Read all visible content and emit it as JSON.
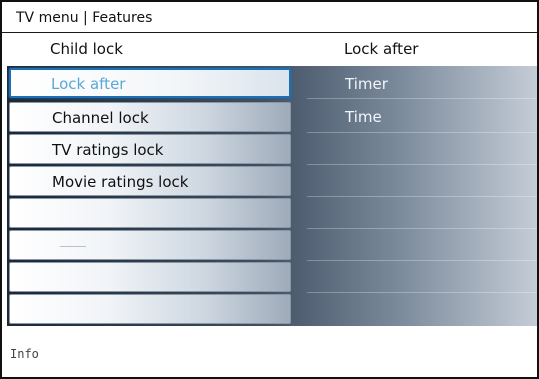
{
  "breadcrumb": "TV menu | Features",
  "header": {
    "left": "Child lock",
    "right": "Lock after"
  },
  "menu": {
    "items": [
      {
        "label": "Lock after",
        "selected": true
      },
      {
        "label": "Channel lock"
      },
      {
        "label": "TV ratings lock"
      },
      {
        "label": "Movie ratings lock"
      },
      {
        "label": ""
      },
      {
        "label": ""
      },
      {
        "label": ""
      },
      {
        "label": ""
      }
    ]
  },
  "submenu": {
    "options": [
      "Timer",
      "Time"
    ]
  },
  "footer": {
    "info": "Info"
  },
  "colors": {
    "selection_border": "#1d6fb6",
    "selected_text": "#5aa8d6"
  }
}
